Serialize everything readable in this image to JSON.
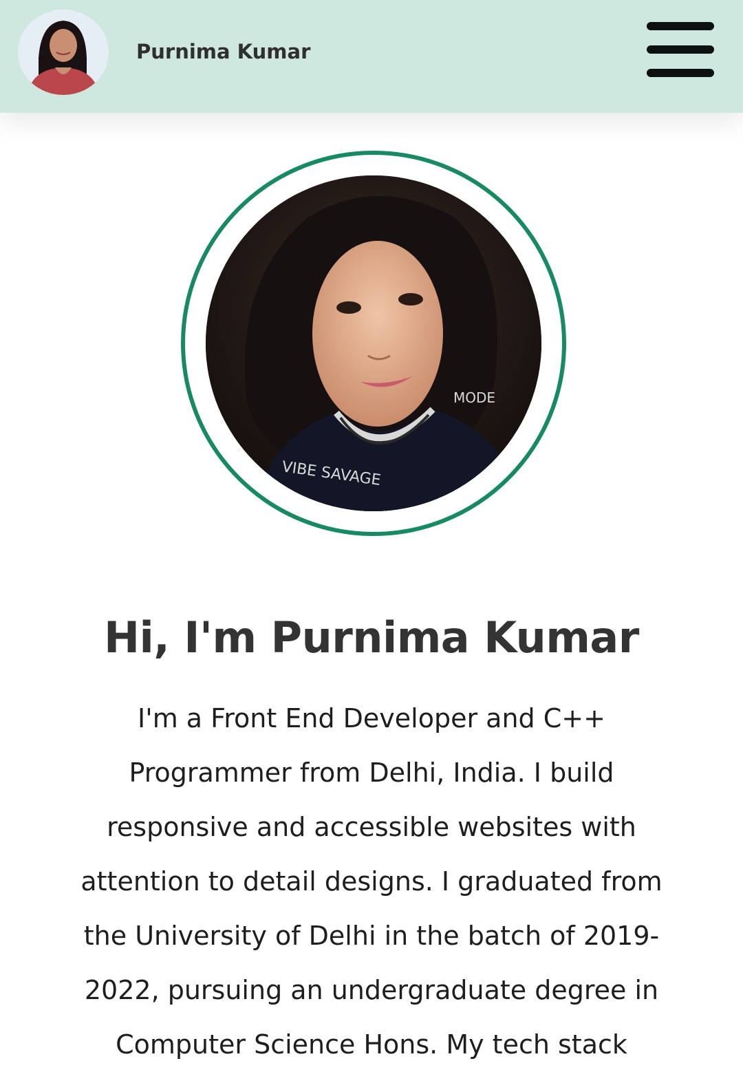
{
  "header": {
    "brand_name": "Purnima Kumar",
    "avatar_icon": "profile-photo",
    "menu_icon": "hamburger-menu-icon",
    "background": "#cfe8df"
  },
  "hero": {
    "photo": "profile-photo",
    "ring_color": "#178a62",
    "title": "Hi, I'm Purnima Kumar"
  },
  "bio": {
    "lines": [
      "I'm a Front End Developer and C++",
      "Programmer from Delhi, India. I build",
      "responsive and accessible websites with",
      "attention to detail designs. I graduated from",
      "the University of Delhi in the batch of 2019-",
      "2022, pursuing an undergraduate degree in",
      "Computer Science Hons. My tech stack"
    ]
  }
}
